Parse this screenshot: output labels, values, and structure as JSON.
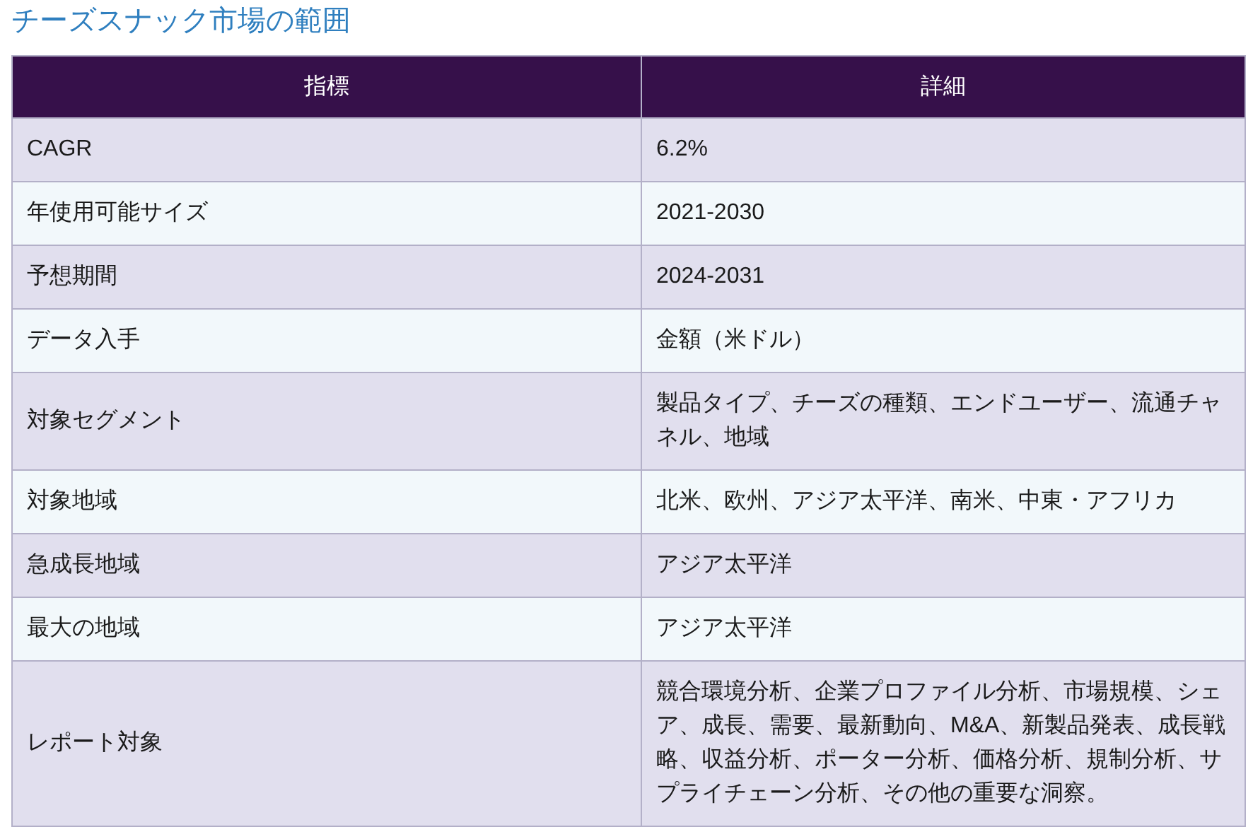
{
  "title": "チーズスナック市場の範囲",
  "table": {
    "columns": [
      "指標",
      "詳細"
    ],
    "rows": [
      [
        "CAGR",
        "6.2%"
      ],
      [
        "年使用可能サイズ",
        "2021-2030"
      ],
      [
        "予想期間",
        "2024-2031"
      ],
      [
        "データ入手",
        "金額（米ドル）"
      ],
      [
        "対象セグメント",
        "製品タイプ、チーズの種類、エンドユーザー、流通チャネル、地域"
      ],
      [
        "対象地域",
        "北米、欧州、アジア太平洋、南米、中東・アフリカ"
      ],
      [
        "急成長地域",
        "アジア太平洋"
      ],
      [
        "最大の地域",
        "アジア太平洋"
      ],
      [
        "レポート対象",
        "競合環境分析、企業プロファイル分析、市場規模、シェア、成長、需要、最新動向、M&A、新製品発表、成長戦略、収益分析、ポーター分析、価格分析、規制分析、サプライチェーン分析、その他の重要な洞察。"
      ]
    ]
  }
}
